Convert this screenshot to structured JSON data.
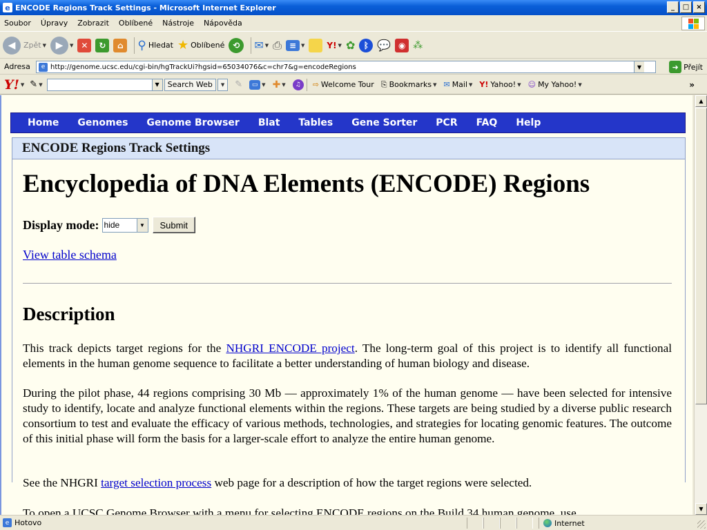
{
  "window": {
    "title": "ENCODE Regions Track Settings - Microsoft Internet Explorer"
  },
  "menu": [
    "Soubor",
    "Úpravy",
    "Zobrazit",
    "Oblíbené",
    "Nástroje",
    "Nápověda"
  ],
  "toolbar": {
    "back": "Zpět",
    "search": "Hledat",
    "favorites": "Oblíbené"
  },
  "address": {
    "label": "Adresa",
    "url": "http://genome.ucsc.edu/cgi-bin/hgTrackUi?hgsid=65034076&c=chr7&g=encodeRegions",
    "go": "Přejít"
  },
  "yahoo": {
    "search_web": "Search Web",
    "welcome_tour": "Welcome Tour",
    "bookmarks": "Bookmarks",
    "mail": "Mail",
    "yahoo": "Yahoo!",
    "my_yahoo": "My Yahoo!"
  },
  "nav": [
    "Home",
    "Genomes",
    "Genome Browser",
    "Blat",
    "Tables",
    "Gene Sorter",
    "PCR",
    "FAQ",
    "Help"
  ],
  "panel_title": "ENCODE Regions Track Settings",
  "heading": "Encyclopedia of DNA Elements (ENCODE) Regions",
  "display_mode": {
    "label": "Display mode:",
    "value": "hide",
    "submit": "Submit"
  },
  "schema_link": "View table schema",
  "description_title": "Description",
  "para1": {
    "pre": "This track depicts target regions for the ",
    "link": "NHGRI ENCODE project",
    "post": ". The long-term goal of this project is to identify all functional elements in the human genome sequence to facilitate a better understanding of human biology and disease."
  },
  "para2": "During the pilot phase, 44 regions comprising 30 Mb — approximately 1% of the human genome — have been selected for intensive study to identify, locate and analyze functional elements within the regions. These targets are being studied by a diverse public research consortium to test and evaluate the efficacy of various methods, technologies, and strategies for locating genomic features. The outcome of this initial phase will form the basis for a larger-scale effort to analyze the entire human genome.",
  "para3": {
    "pre": "See the NHGRI ",
    "link": "target selection process",
    "post": " web page for a description of how the target regions were selected."
  },
  "para4": "To open a UCSC Genome Browser with a menu for selecting ENCODE regions on the Build 34 human genome, use",
  "status": {
    "text": "Hotovo",
    "zone": "Internet"
  },
  "colors": {
    "nav_bg": "#2436c9",
    "page_bg": "#fffef0",
    "panel_head": "#d8e4f8",
    "link": "#0000cc"
  }
}
